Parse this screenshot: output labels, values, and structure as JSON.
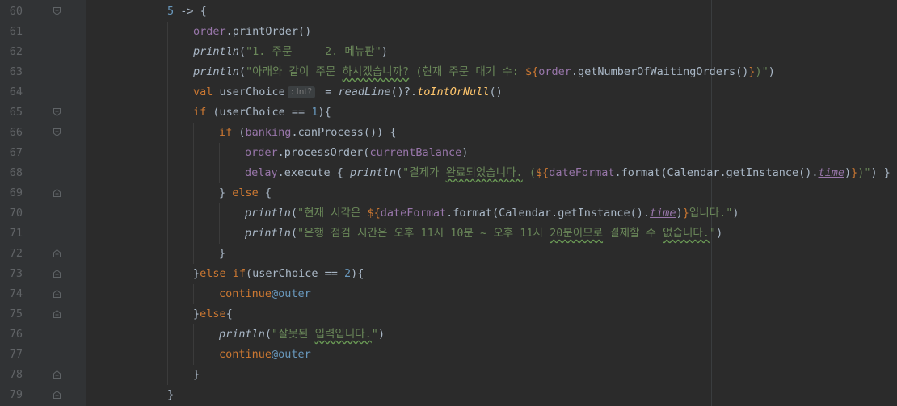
{
  "editor": {
    "language": "Kotlin",
    "theme": "darcula",
    "lines": [
      {
        "number": "60",
        "text": "5 -> {"
      },
      {
        "number": "61",
        "text": "order.printOrder()"
      },
      {
        "number": "62",
        "text": "println(\"1. 주문     2. 메뉴판\")"
      },
      {
        "number": "63",
        "text": "println(\"아래와 같이 주문 하시겠습니까? (현재 주문 대기 수: ${order.getNumberOfWaitingOrders()})\")"
      },
      {
        "number": "64",
        "text": "val userChoice : Int? = readLine()?.toIntOrNull()"
      },
      {
        "number": "65",
        "text": "if (userChoice == 1){"
      },
      {
        "number": "66",
        "text": "if (banking.canProcess()) {"
      },
      {
        "number": "67",
        "text": "order.processOrder(currentBalance)"
      },
      {
        "number": "68",
        "text": "delay.execute { println(\"결제가 완료되었습니다. (${dateFormat.format(Calendar.getInstance().time)})\") }"
      },
      {
        "number": "69",
        "text": "} else {"
      },
      {
        "number": "70",
        "text": "println(\"현재 시각은 ${dateFormat.format(Calendar.getInstance().time)}입니다.\")"
      },
      {
        "number": "71",
        "text": "println(\"은행 점검 시간은 오후 11시 10분 ~ 오후 11시 20분이므로 결제할 수 없습니다.\")"
      },
      {
        "number": "72",
        "text": "}"
      },
      {
        "number": "73",
        "text": "}else if(userChoice == 2){"
      },
      {
        "number": "74",
        "text": "continue@outer"
      },
      {
        "number": "75",
        "text": "}else{"
      },
      {
        "number": "76",
        "text": "println(\"잘못된 입력입니다.\")"
      },
      {
        "number": "77",
        "text": "continue@outer"
      },
      {
        "number": "78",
        "text": "}"
      },
      {
        "number": "79",
        "text": "}"
      }
    ]
  },
  "tokens": {
    "l60": {
      "a": "5",
      "b": " -> {"
    },
    "l61": {
      "a": "order",
      "b": ".printOrder()"
    },
    "l62": {
      "a": "println",
      "b": "(",
      "c": "\"1. 주문     2. 메뉴판\"",
      "d": ")"
    },
    "l63": {
      "a": "println",
      "b": "(",
      "c": "\"아래와 같이 주문 ",
      "d": "하시겠습니까?",
      "e": " (현재 주문 대기 수: ",
      "f": "${",
      "g": "order",
      "h": ".getNumberOfWaitingOrders()",
      "i": "}",
      "j": ")\"",
      "k": ")"
    },
    "l64": {
      "a": "val",
      "b": " userChoice",
      "hint": ": Int?",
      "c": " = ",
      "d": "readLine",
      "e": "()?.",
      "f": "toIntOrNull",
      "g": "()"
    },
    "l65": {
      "a": "if",
      "b": " (userChoice == ",
      "c": "1",
      "d": "){"
    },
    "l66": {
      "a": "if",
      "b": " (",
      "c": "banking",
      "d": ".canProcess()) {"
    },
    "l67": {
      "a": "order",
      "b": ".processOrder(",
      "c": "currentBalance",
      "d": ")"
    },
    "l68": {
      "a": "delay",
      "b": ".execute { ",
      "c": "println",
      "d": "(",
      "e": "\"결제가 ",
      "f": "완료되었습니다.",
      "g": " (",
      "h": "${",
      "i": "dateFormat",
      "j": ".format(Calendar.getInstance().",
      "k": "time",
      "l": ")",
      "m": "}",
      "n": ")\"",
      "o": ") }"
    },
    "l69": {
      "a": "} ",
      "b": "else",
      "c": " {"
    },
    "l70": {
      "a": "println",
      "b": "(",
      "c": "\"현재 시각은 ",
      "d": "${",
      "e": "dateFormat",
      "f": ".format(Calendar.getInstance().",
      "g": "time",
      "h": ")",
      "i": "}",
      "j": "입니다.\"",
      "k": ")"
    },
    "l71": {
      "a": "println",
      "b": "(",
      "c": "\"은행 점검 시간은 오후 11시 10분 ~ 오후 11시 ",
      "d": "20분이므로",
      "e": " 결제할 수 ",
      "f": "없습니다.",
      "g": "\"",
      "h": ")"
    },
    "l72": {
      "a": "}"
    },
    "l73": {
      "a": "}",
      "b": "else if",
      "c": "(userChoice == ",
      "d": "2",
      "e": "){"
    },
    "l74": {
      "a": "continue",
      "b": "@outer"
    },
    "l75": {
      "a": "}",
      "b": "else",
      "c": "{"
    },
    "l76": {
      "a": "println",
      "b": "(",
      "c": "\"잘못된 ",
      "d": "입력입니다.",
      "e": "\"",
      "f": ")"
    },
    "l77": {
      "a": "continue",
      "b": "@outer"
    },
    "l78": {
      "a": "}"
    },
    "l79": {
      "a": "}"
    }
  },
  "colors": {
    "background": "#2b2b2b",
    "gutter": "#313335",
    "line_number": "#606366",
    "keyword": "#cc7832",
    "string": "#6a8759",
    "number": "#6897bb",
    "property": "#9876aa",
    "function": "#ffc66d",
    "default_text": "#a9b7c6"
  },
  "icons": {
    "fold_open": "fold-open-icon",
    "fold_close": "fold-close-icon"
  }
}
